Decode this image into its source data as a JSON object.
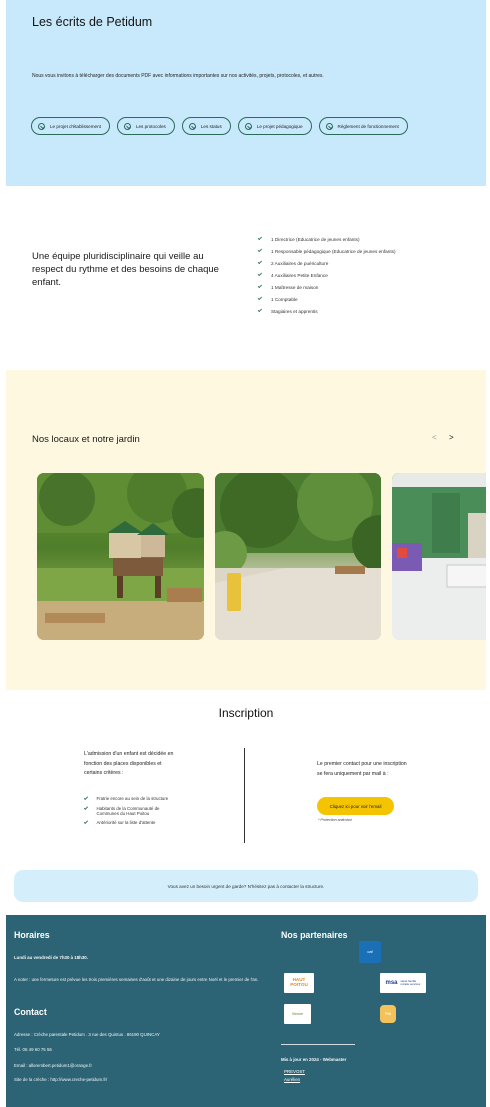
{
  "ecrits": {
    "title": "Les écrits de Petidum",
    "intro": "Nous vous invitons à télécharger des documents PDF avec informations importantes sur nos activités, projets, protocoles, et autres.",
    "documents": [
      {
        "label": "Le projet d'établissement",
        "icon": "download-icon"
      },
      {
        "label": "Les protocoles",
        "icon": "download-icon"
      },
      {
        "label": "Les status",
        "icon": "download-icon"
      },
      {
        "label": "Le projet pédagogique",
        "icon": "download-icon"
      },
      {
        "label": "Règlement de fonctionnement",
        "icon": "download-icon"
      }
    ],
    "background": "#c8e8fb"
  },
  "team": {
    "title": "Une équipe pluridisciplinaire qui veille au respect du rythme et des besoins de chaque enfant.",
    "members": [
      "1 Directrice (Educatrice de jeunes enfants)",
      "1 Responsable pédagogique (Educatrice de jeunes enfants)",
      "2 Auxiliaires de puériculture",
      "4 Auxiliaires Petite Enfance",
      "1 Maîtresse de maison",
      "1 Comptable",
      "Stagiaires et apprentis"
    ]
  },
  "locaux": {
    "title": "Nos locaux et notre jardin",
    "prev_label": "<",
    "next_label": ">",
    "background": "#fef8e1"
  },
  "inscription": {
    "title": "Inscription",
    "left_text": "L'admission d'un enfant est décidée en fonction des places disponibles et certains critères :",
    "criteria": [
      "Fratrie encore au sein de la structure",
      "Habitants de la Communauté de Communes du Haut Poitou",
      "Antériorité sur la liste d'attente"
    ],
    "right_text": "Le premier contact pour une inscription se fera uniquement par mail à :",
    "mail_button": "Cliquez ici pour voir l'email",
    "note": "* Protection antirobot",
    "urgent": "Vous avez un besoin urgent de garde? N'hésitez pas à contacter la structure.",
    "button_color": "#f5c400"
  },
  "footer": {
    "background": "#2c6475",
    "horaires_title": "Horaires",
    "horaires_line1": "Lundi au vendredi de 7h30 à 18h30.",
    "horaires_note": "A noter : une fermeture est prévue les trois premières semaines d'août et une dizaine de jours entre Noël et le premier de l'an.",
    "contact_title": "Contact",
    "address": "Adresse : Crèche parentale Petidum . 3 rue des Quintus . 86190 QUINCAY",
    "tel": "Tél. 05 49 60 75 56",
    "email": "Email : allorembert.petidum1@orange.fr",
    "site": "Site de la crèche : http://www.creche-petidum.fr/",
    "partners_title": "Nos partenaires",
    "partner_logos": {
      "caf": "caf",
      "haut_poitou": "HAUT POITOU",
      "msa": "msa",
      "msa_tagline": "santé famille retraite services",
      "small": "Vienne",
      "round": "PMI"
    },
    "updated": "Mis à jour en 2024 - Webmaster",
    "link1": "PREVOST",
    "link2": "Aurélien"
  }
}
